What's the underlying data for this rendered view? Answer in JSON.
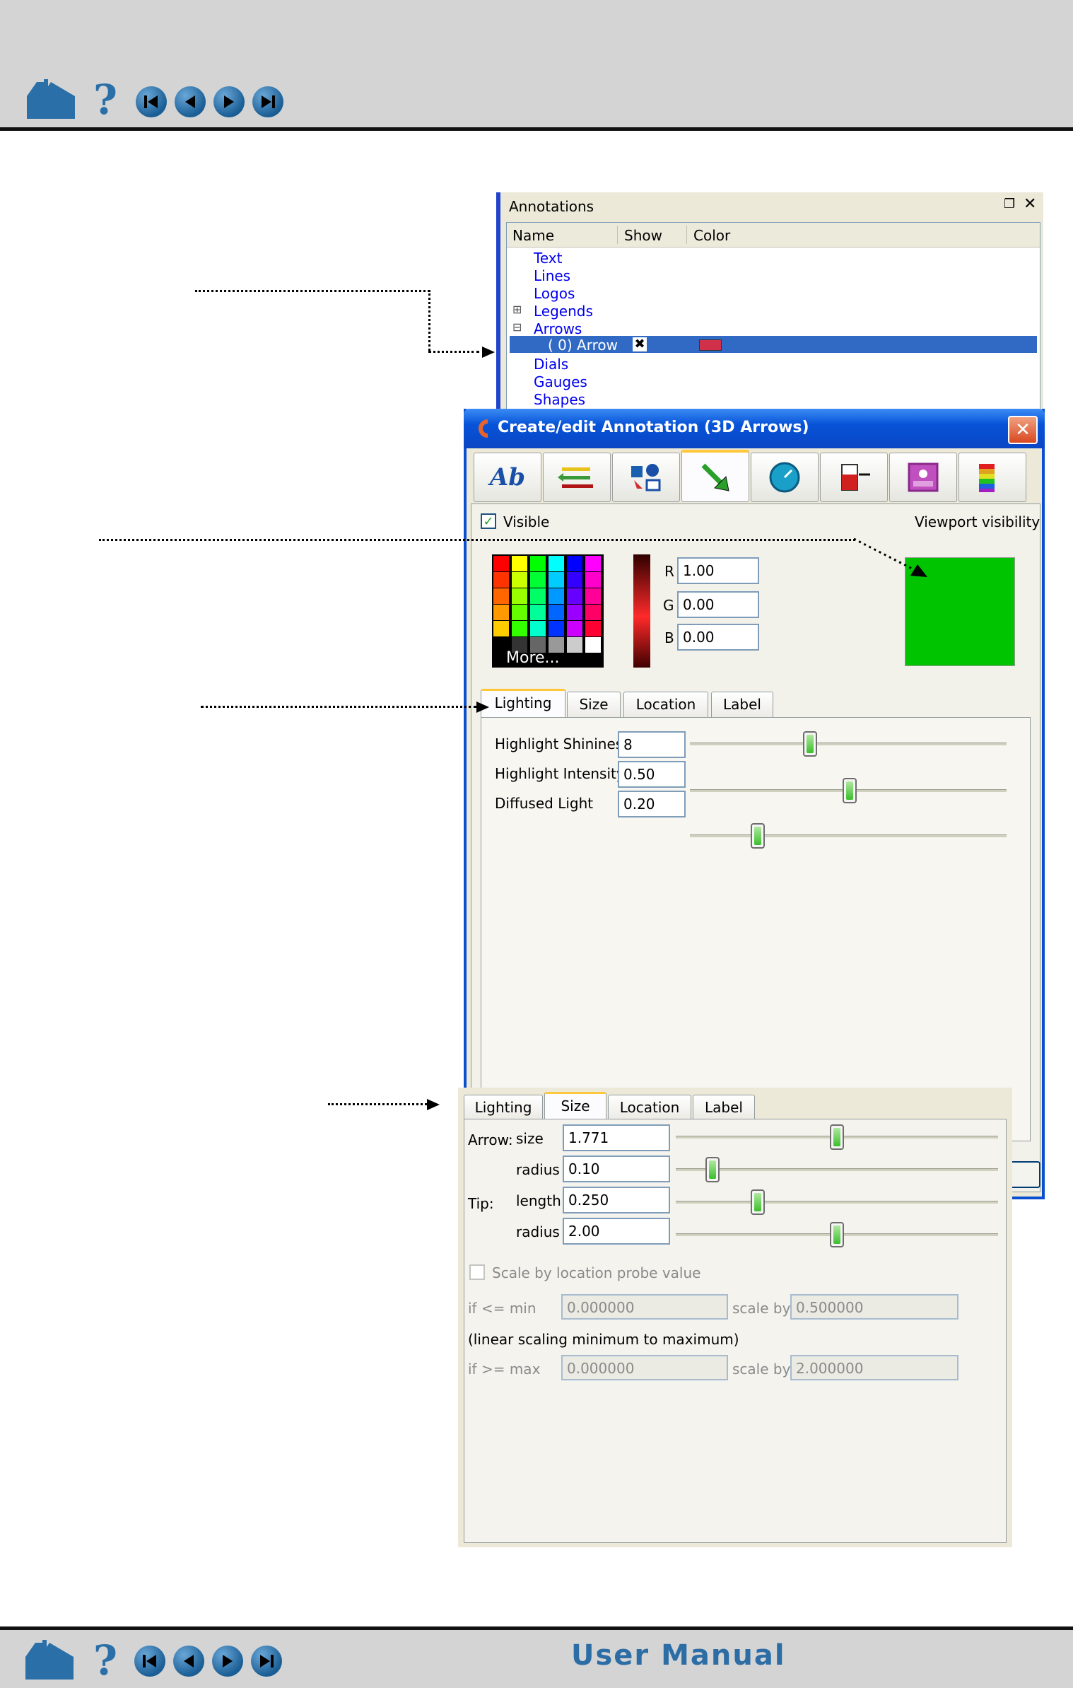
{
  "nav": {
    "footer_title": "User Manual"
  },
  "annotations_panel": {
    "title": "Annotations",
    "columns": [
      "Name",
      "Show",
      "Color"
    ],
    "tree": [
      "Text",
      "Lines",
      "Logos",
      "Legends",
      "Arrows",
      "( 0) Arrow",
      "Dials",
      "Gauges",
      "Shapes"
    ],
    "selected_color": "#d0304a"
  },
  "dialog": {
    "title": "Create/edit Annotation (3D Arrows)",
    "visible_label": "Visible",
    "viewport_visibility": "Viewport visibility",
    "r_label": "R",
    "g_label": "G",
    "b_label": "B",
    "r": "1.00",
    "g": "0.00",
    "b": "0.00",
    "more_label": "More...",
    "viewport_color": "#00c400",
    "tabs": [
      "Lighting",
      "Size",
      "Location",
      "Label"
    ],
    "lighting": {
      "shininess_label": "Highlight Shininess",
      "shininess": "8",
      "intensity_label": "Highlight Intensity",
      "intensity": "0.50",
      "diffused_label": "Diffused Light",
      "diffused": "0.20"
    }
  },
  "size_panel": {
    "tabs": [
      "Lighting",
      "Size",
      "Location",
      "Label"
    ],
    "arrow_label": "Arrow:",
    "tip_label": "Tip:",
    "size_label": "size",
    "size": "1.771",
    "radius_label": "radius",
    "arrow_radius": "0.10",
    "length_label": "length",
    "tip_length": "0.250",
    "tip_radius": "2.00",
    "scale_probe_label": "Scale by location probe value",
    "if_min_label": "if <= min",
    "min_value": "0.000000",
    "scale_by_label": "scale by",
    "min_scale": "0.500000",
    "linear_label": "(linear scaling minimum to maximum)",
    "if_max_label": "if >= max",
    "max_value": "0.000000",
    "max_scale": "2.000000"
  }
}
